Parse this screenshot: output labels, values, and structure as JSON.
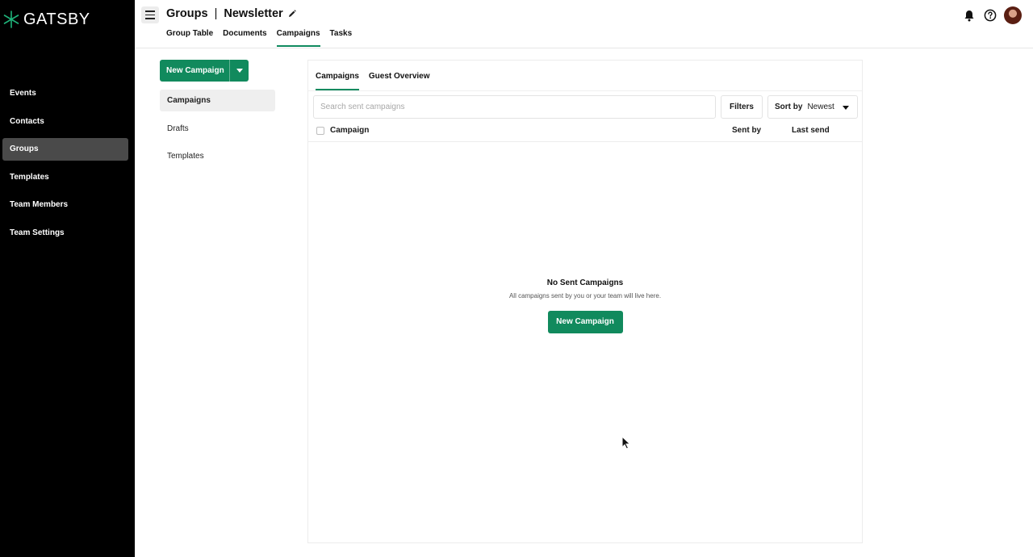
{
  "brand": {
    "name": "GATSBY",
    "accent": "#118a5d"
  },
  "sidebar": {
    "items": [
      {
        "label": "Events",
        "active": false
      },
      {
        "label": "Contacts",
        "active": false
      },
      {
        "label": "Groups",
        "active": true
      },
      {
        "label": "Templates",
        "active": false
      },
      {
        "label": "Team Members",
        "active": false
      },
      {
        "label": "Team Settings",
        "active": false
      }
    ]
  },
  "header": {
    "section": "Groups",
    "separator": "|",
    "title": "Newsletter",
    "tabs": [
      {
        "label": "Group Table",
        "active": false
      },
      {
        "label": "Documents",
        "active": false
      },
      {
        "label": "Campaigns",
        "active": true
      },
      {
        "label": "Tasks",
        "active": false
      }
    ],
    "icons": [
      "bell-icon",
      "help-icon",
      "avatar"
    ]
  },
  "left_panel": {
    "new_campaign_label": "New Campaign",
    "items": [
      {
        "label": "Campaigns",
        "active": true
      },
      {
        "label": "Drafts",
        "active": false
      },
      {
        "label": "Templates",
        "active": false
      }
    ]
  },
  "main": {
    "tabs": [
      {
        "label": "Campaigns",
        "active": true
      },
      {
        "label": "Guest Overview",
        "active": false
      }
    ],
    "search_placeholder": "Search sent campaigns",
    "filters_label": "Filters",
    "sort_label": "Sort by",
    "sort_value": "Newest",
    "columns": {
      "campaign": "Campaign",
      "sent_by": "Sent by",
      "last_send": "Last send"
    },
    "empty": {
      "title": "No Sent Campaigns",
      "subtitle": "All campaigns sent by you or your team will live here.",
      "button": "New Campaign"
    }
  }
}
